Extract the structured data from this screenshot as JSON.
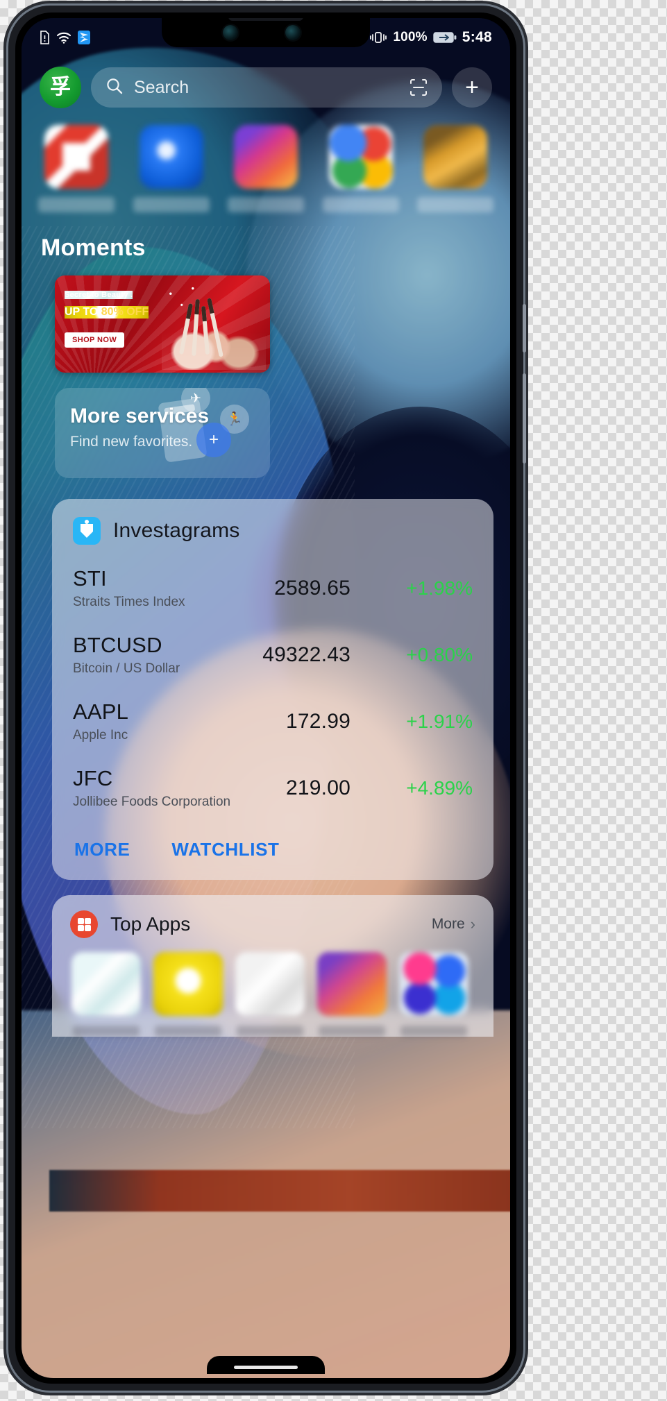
{
  "status_bar": {
    "icons_left": [
      "sim-card-icon",
      "wifi-icon",
      "messaging-app-icon"
    ],
    "vibrate_icon": "vibrate-icon",
    "battery_percent": "100%",
    "battery_icon": "battery-charging-icon",
    "time": "5:48"
  },
  "header": {
    "logo_name": "app-logo",
    "logo_glyph": "孚",
    "search_placeholder": "Search",
    "search_value": "",
    "search_icon": "search-icon",
    "scan_icon": "scan-code-icon",
    "add_label": "+"
  },
  "app_row": {
    "apps": [
      {
        "name": "app-1",
        "label": ""
      },
      {
        "name": "app-2",
        "label": ""
      },
      {
        "name": "app-3",
        "label": ""
      },
      {
        "name": "app-4",
        "label": ""
      },
      {
        "name": "app-5",
        "label": ""
      }
    ]
  },
  "moments": {
    "title": "Moments",
    "promo": {
      "line1": "Secret to Beauty .",
      "line2_pre": "UP TO ",
      "line2_em": "80% OFF",
      "cta": "SHOP NOW"
    }
  },
  "services": {
    "title": "More services",
    "subtitle": "Find new favorites.",
    "bubble_icons": [
      "airplane-icon",
      "running-icon",
      "plus-circle-icon"
    ]
  },
  "widget": {
    "icon": "investagrams-icon",
    "title": "Investagrams",
    "positive_color": "#2bd24a",
    "link_color": "#1a73e8",
    "quotes": [
      {
        "symbol": "STI",
        "name": "Straits Times Index",
        "price": "2589.65",
        "change": "+1.98%"
      },
      {
        "symbol": "BTCUSD",
        "name": "Bitcoin / US Dollar",
        "price": "49322.43",
        "change": "+0.80%"
      },
      {
        "symbol": "AAPL",
        "name": "Apple Inc",
        "price": "172.99",
        "change": "+1.91%"
      },
      {
        "symbol": "JFC",
        "name": "Jollibee Foods Corporation",
        "price": "219.00",
        "change": "+4.89%"
      }
    ],
    "actions": [
      {
        "name": "more",
        "label": "MORE"
      },
      {
        "name": "watchlist",
        "label": "WATCHLIST"
      }
    ]
  },
  "top_apps": {
    "icon": "app-grid-icon",
    "title": "Top Apps",
    "more_label": "More",
    "chevron": "›",
    "apps": [
      {
        "name": "top-app-1",
        "label": ""
      },
      {
        "name": "top-app-2",
        "label": ""
      },
      {
        "name": "top-app-3",
        "label": ""
      },
      {
        "name": "top-app-4",
        "label": ""
      },
      {
        "name": "top-app-5",
        "label": ""
      }
    ]
  }
}
